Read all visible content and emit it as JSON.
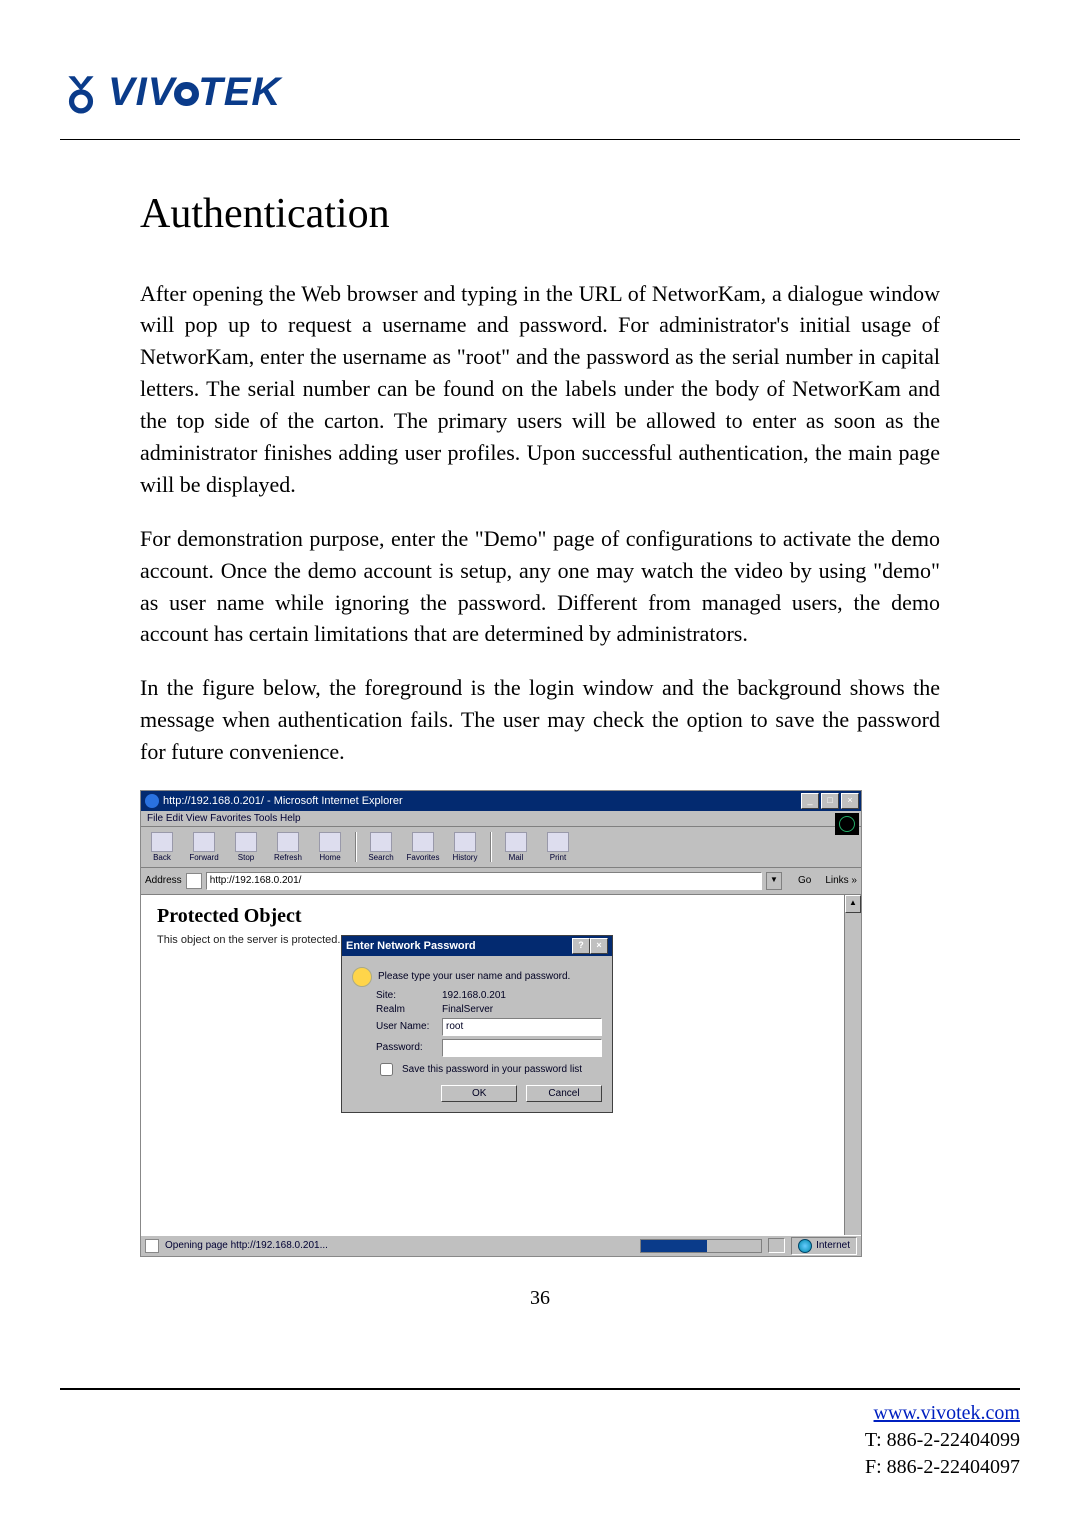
{
  "logo_text_parts": [
    "VIV",
    "TEK"
  ],
  "heading": "Authentication",
  "para1": "After opening the Web browser and typing in the URL of NetworKam, a dialogue window will pop up to request a username and password. For administrator's initial usage of NetworKam, enter the username as \"root\" and the password as the serial number in capital letters. The serial number can be found on the labels under the body of NetworKam and the top side of the carton. The primary users will be allowed to enter as soon as the administrator finishes adding user profiles. Upon successful authentication, the main page will be displayed.",
  "para2": "For demonstration purpose, enter the \"Demo\" page of configurations to activate the demo account. Once the demo account is setup, any one may watch the video by using \"demo\" as user name while ignoring the password. Different from managed users, the demo account has certain limitations that are determined by administrators.",
  "para3": "In the figure below, the foreground is the login window and the background shows the message when authentication fails. The user may check the option to save the password for future convenience.",
  "ie": {
    "title": "http://192.168.0.201/ - Microsoft Internet Explorer",
    "menu": "File   Edit   View   Favorites   Tools   Help",
    "toolbar": [
      "Back",
      "Forward",
      "Stop",
      "Refresh",
      "Home",
      "Search",
      "Favorites",
      "History",
      "Mail",
      "Print"
    ],
    "address_label": "Address",
    "address_value": "http://192.168.0.201/",
    "go_label": "Go",
    "links_label": "Links »",
    "body_title": "Protected Object",
    "body_sub": "This object on the server is protected.",
    "status_left": "Opening page http://192.168.0.201...",
    "status_zone": "Internet"
  },
  "dialog": {
    "title": "Enter Network Password",
    "prompt": "Please type your user name and password.",
    "site_label": "Site:",
    "site_value": "192.168.0.201",
    "realm_label": "Realm",
    "realm_value": "FinalServer",
    "user_label": "User Name:",
    "user_value": "root",
    "pass_label": "Password:",
    "pass_value": "",
    "save_label": "Save this password in your password list",
    "ok": "OK",
    "cancel": "Cancel"
  },
  "page_number": "36",
  "footer": {
    "url": "www.vivotek.com",
    "tel": "T: 886-2-22404099",
    "fax": "F: 886-2-22404097"
  }
}
